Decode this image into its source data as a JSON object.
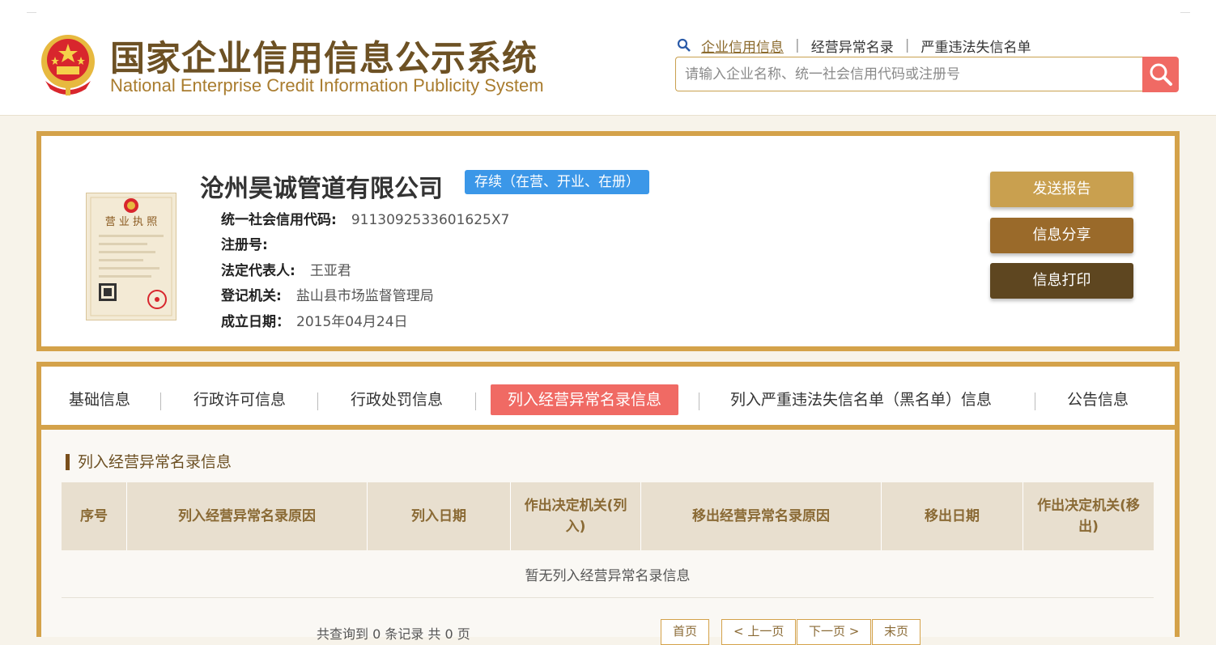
{
  "header": {
    "title_cn": "国家企业信用信息公示系统",
    "title_en": "National Enterprise Credit Information Publicity System",
    "nav": [
      "企业信用信息",
      "经营异常名录",
      "严重违法失信名单"
    ],
    "search_placeholder": "请输入企业名称、统一社会信用代码或注册号"
  },
  "company": {
    "name": "沧州昊诚管道有限公司",
    "status": "存续（在营、开业、在册）",
    "fields": [
      {
        "label": "统一社会信用代码:",
        "value": "9113092533601625X7"
      },
      {
        "label": "注册号:",
        "value": ""
      },
      {
        "label": "法定代表人:",
        "value": "王亚君"
      },
      {
        "label": "登记机关:",
        "value": "盐山县市场监督管理局"
      },
      {
        "label": "成立日期：",
        "value": "2015年04月24日"
      }
    ],
    "license_title": "营 业 执 照"
  },
  "actions": {
    "send_report": "发送报告",
    "share": "信息分享",
    "print": "信息打印"
  },
  "tabs": [
    "基础信息",
    "行政许可信息",
    "行政处罚信息",
    "列入经营异常名录信息",
    "列入严重违法失信名单（黑名单）信息",
    "公告信息"
  ],
  "section": {
    "title": "列入经营异常名录信息",
    "columns": [
      "序号",
      "列入经营异常名录原因",
      "列入日期",
      "作出决定机关(列入)",
      "移出经营异常名录原因",
      "移出日期",
      "作出决定机关(移出)"
    ],
    "empty_text": "暂无列入经营异常名录信息"
  },
  "pager": {
    "info": "共查询到 0 条记录 共 0 页",
    "first": "首页",
    "prev": "< 上一页",
    "next": "下一页 >",
    "last": "末页"
  },
  "colors": {
    "gold_border": "#d4a24a",
    "brown_title": "#6d5124",
    "status_blue": "#3b97e8",
    "active_tab": "#f06a64",
    "btn_send": "#c9a04f",
    "btn_share": "#9a6a2a",
    "btn_print": "#5e4620"
  }
}
